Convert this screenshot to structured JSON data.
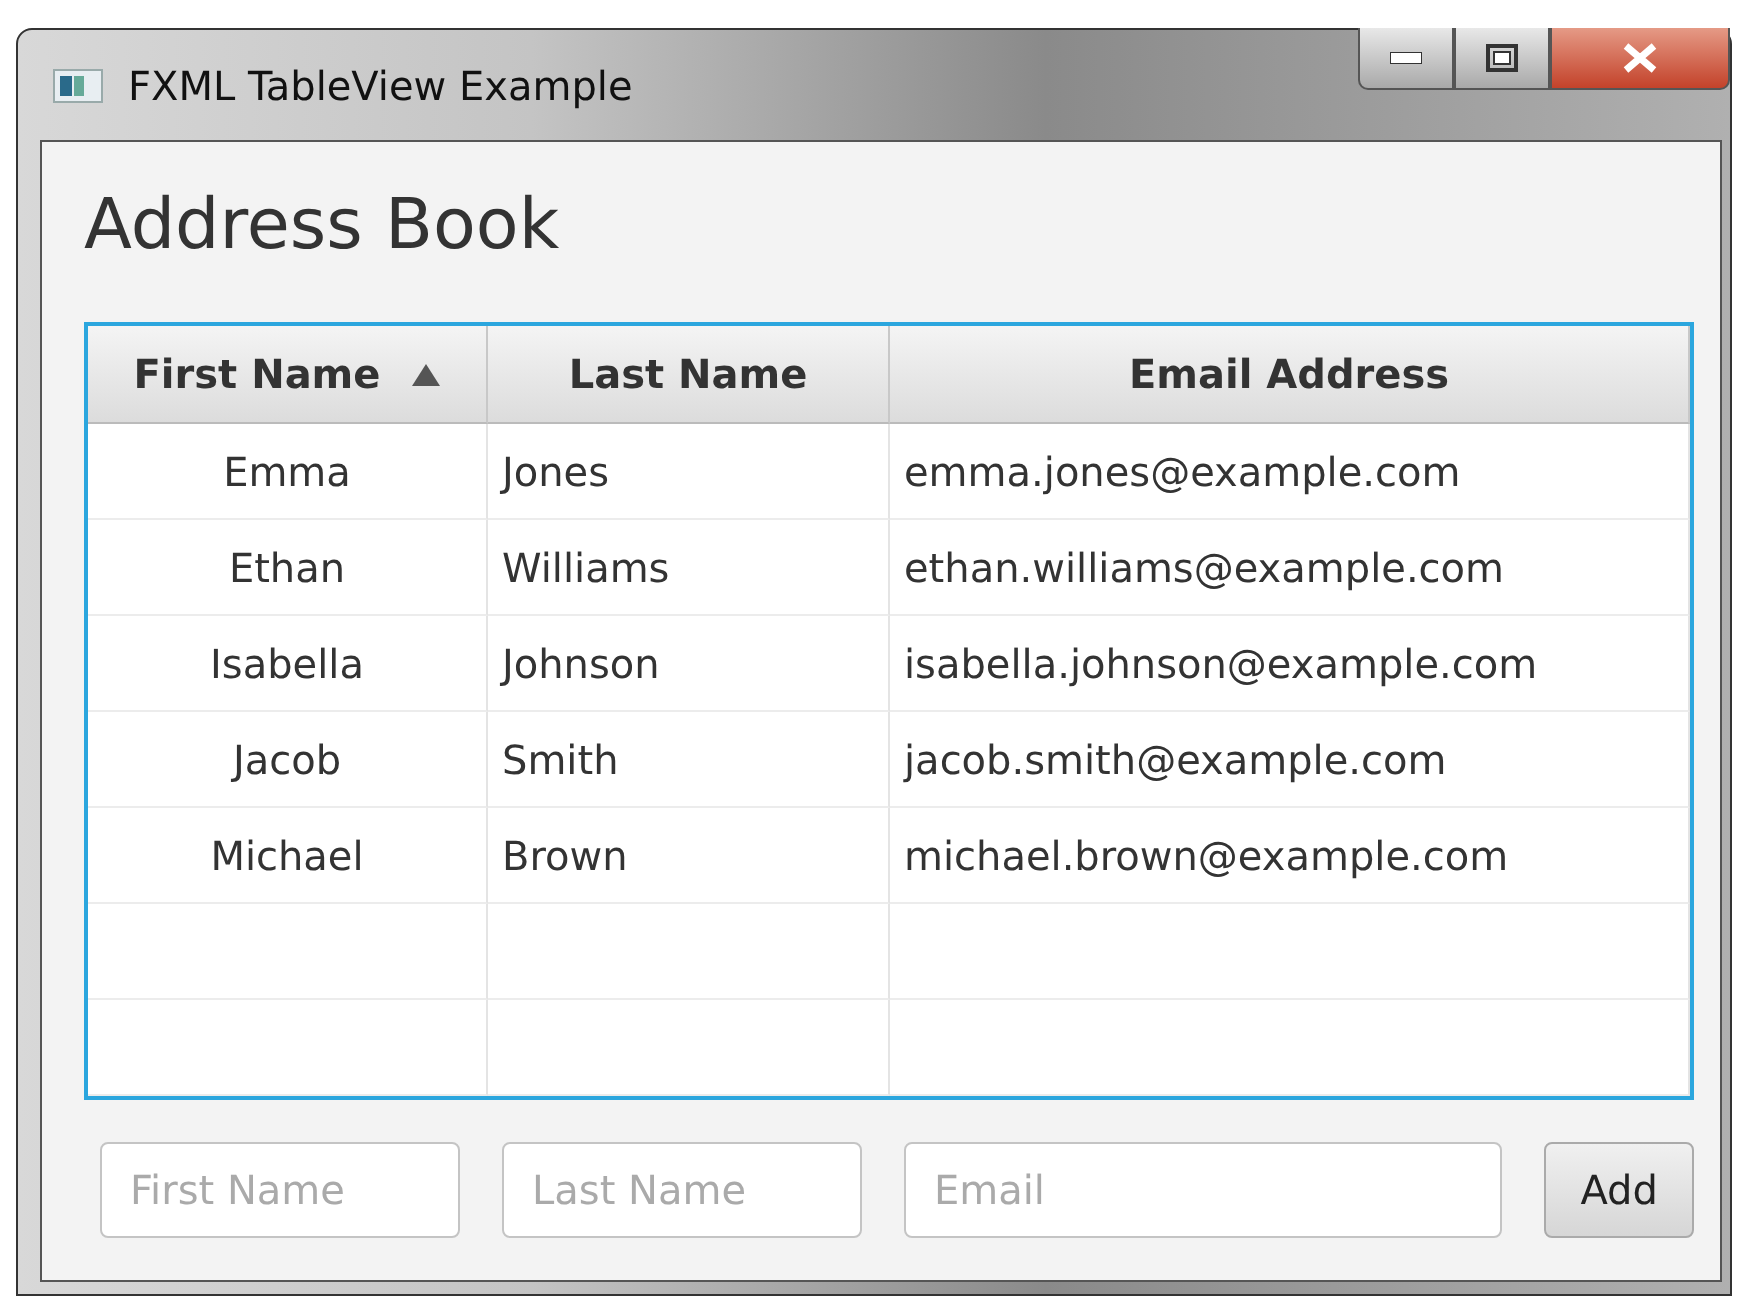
{
  "window": {
    "title": "FXML TableView Example"
  },
  "heading": "Address Book",
  "table": {
    "columns": [
      {
        "label": "First Name",
        "sorted": true
      },
      {
        "label": "Last Name",
        "sorted": false
      },
      {
        "label": "Email Address",
        "sorted": false
      }
    ],
    "rows": [
      [
        "Emma",
        "Jones",
        "emma.jones@example.com"
      ],
      [
        "Ethan",
        "Williams",
        "ethan.williams@example.com"
      ],
      [
        "Isabella",
        "Johnson",
        "isabella.johnson@example.com"
      ],
      [
        "Jacob",
        "Smith",
        "jacob.smith@example.com"
      ],
      [
        "Michael",
        "Brown",
        "michael.brown@example.com"
      ]
    ]
  },
  "form": {
    "fields": [
      {
        "placeholder": "First Name"
      },
      {
        "placeholder": "Last Name"
      },
      {
        "placeholder": "Email"
      }
    ],
    "button": "Add"
  }
}
